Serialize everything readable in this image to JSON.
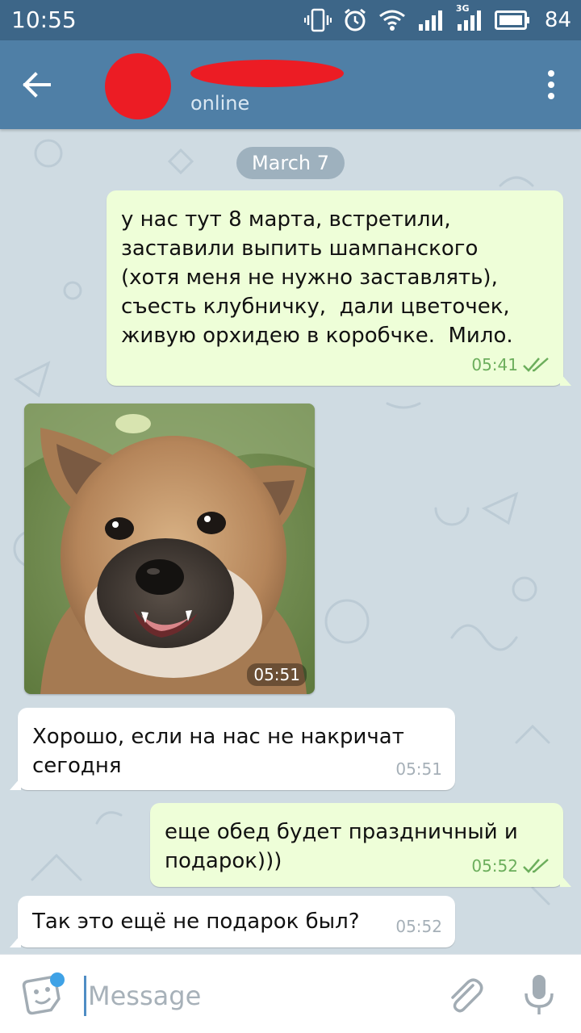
{
  "status_bar": {
    "time": "10:55",
    "network_label": "3G",
    "battery_level": "84",
    "icons": [
      "vibrate-icon",
      "alarm-icon",
      "wifi-icon",
      "signal-icon",
      "signal-3g-icon",
      "battery-icon"
    ]
  },
  "header": {
    "name": "",
    "status": "online",
    "back_icon": "arrow-left-icon",
    "menu_icon": "more-vertical-icon",
    "colors": {
      "bar": "#4f7fa6",
      "status_bar": "#3d6688",
      "redaction": "#ec1c24"
    }
  },
  "chat": {
    "date": "March 7",
    "messages": [
      {
        "direction": "outgoing",
        "type": "text",
        "text": "у нас тут 8 марта, встретили,\nзаставили выпить шампанского\n(хотя меня не нужно заставлять),\nсъесть клубничку,  дали цветочек,\nживую орхидею в коробчке.  Мило.",
        "time": "05:41",
        "read": true
      },
      {
        "direction": "incoming",
        "type": "photo",
        "subject": "smiling puppy",
        "time": "05:51"
      },
      {
        "direction": "incoming",
        "type": "text",
        "text": "Хорошо, если на нас не накричат\nсегодня",
        "time": "05:51"
      },
      {
        "direction": "outgoing",
        "type": "text",
        "text": "еще обед будет праздничный и\nподарок)))",
        "time": "05:52",
        "read": true
      },
      {
        "direction": "incoming",
        "type": "text",
        "text": "Так это ещё не подарок был?",
        "time": "05:52"
      }
    ],
    "colors": {
      "background": "#cfdbe2",
      "outgoing": "#eefed8",
      "incoming": "#ffffff",
      "check": "#6cae5c"
    }
  },
  "composer": {
    "placeholder": "Message",
    "value": "",
    "emoji_icon": "sticker-icon",
    "attach_icon": "paperclip-icon",
    "mic_icon": "microphone-icon"
  }
}
